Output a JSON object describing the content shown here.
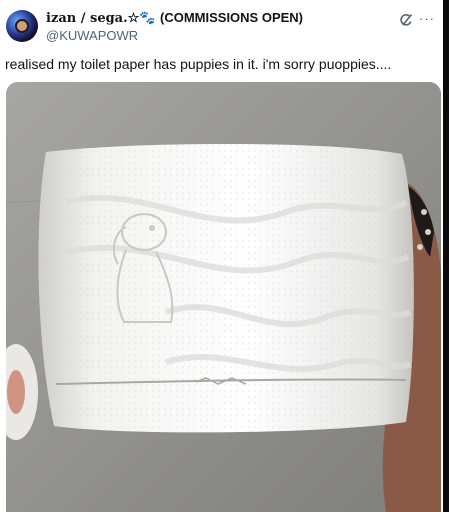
{
  "tweet": {
    "display_name": "izan / sega.",
    "name_emojis": "☆🐾",
    "name_suffix": "(COMMISSIONS OPEN)",
    "handle": "@KUWAPOWR",
    "text": "realised my toilet paper has puppies in it. i'm sorry puoppies....",
    "more_symbol": "···"
  },
  "icons": {
    "grok": "grok-icon",
    "more": "more-icon",
    "avatar": "avatar"
  },
  "colors": {
    "text": "#0f1419",
    "muted": "#536471",
    "background": "#ffffff"
  }
}
